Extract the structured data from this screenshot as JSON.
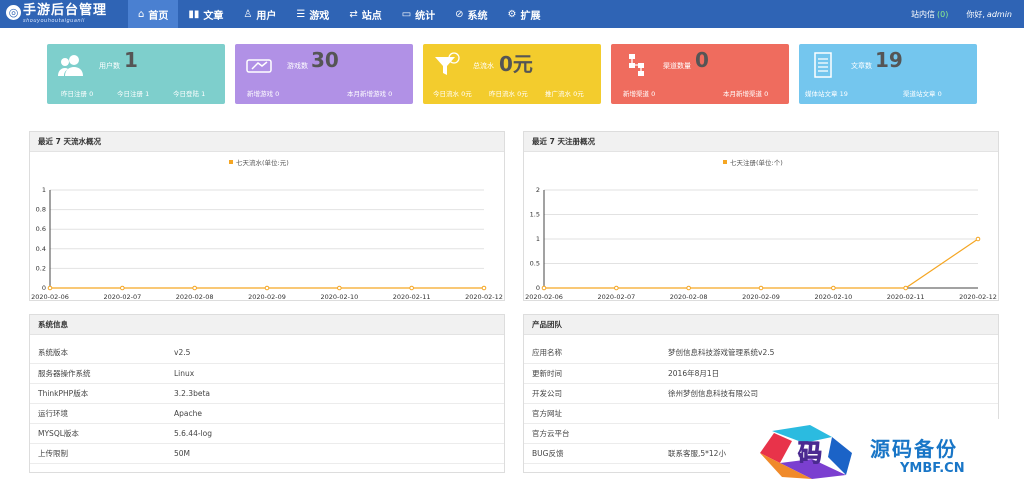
{
  "app": {
    "logo_text": "手游后台管理",
    "logo_sub": "shouyouhoutaiguanli"
  },
  "nav": [
    {
      "label": "首页",
      "icon": "home-icon"
    },
    {
      "label": "文章",
      "icon": "bar-chart-icon"
    },
    {
      "label": "用户",
      "icon": "user-icon"
    },
    {
      "label": "游戏",
      "icon": "list-icon"
    },
    {
      "label": "站点",
      "icon": "exchange-icon"
    },
    {
      "label": "统计",
      "icon": "monitor-icon"
    },
    {
      "label": "系统",
      "icon": "link-icon"
    },
    {
      "label": "扩展",
      "icon": "gear-icon"
    }
  ],
  "topright": {
    "messages_label": "站内信",
    "messages_count": "(0)",
    "greeting": "你好,",
    "user": "admin"
  },
  "stats": [
    {
      "label": "用户数",
      "value": "1",
      "color": "#7ecfcc",
      "icon": "users-icon",
      "foot": [
        "昨日注册 0",
        "今日注册 1",
        "今日登陆 1"
      ]
    },
    {
      "label": "游戏数",
      "value": "30",
      "color": "#b191e6",
      "icon": "gamepad-icon",
      "foot": [
        "新增游戏 0",
        "本月新增游戏 0"
      ]
    },
    {
      "label": "总流水",
      "value": "0元",
      "color": "#f3cc2d",
      "icon": "funnel-icon",
      "foot": [
        "今日流水 0元",
        "昨日流水 0元",
        "推广流水 0元"
      ]
    },
    {
      "label": "渠道数量",
      "value": "0",
      "color": "#ef6c5e",
      "icon": "sitemap-icon",
      "foot": [
        "新增渠道 0",
        "本月新增渠道 0"
      ]
    },
    {
      "label": "文章数",
      "value": "19",
      "color": "#74c6ee",
      "icon": "document-icon",
      "foot": [
        "媒体站文章 19",
        "渠道站文章 0"
      ]
    }
  ],
  "charts": {
    "left_title": "最近 7 天流水概况",
    "right_title": "最近 7 天注册概况"
  },
  "chart_data": [
    {
      "type": "line",
      "title": "最近 7 天流水概况",
      "x": [
        "2020-02-06",
        "2020-02-07",
        "2020-02-08",
        "2020-02-09",
        "2020-02-10",
        "2020-02-11",
        "2020-02-12"
      ],
      "series": [
        {
          "name": "七天流水(单位:元)",
          "values": [
            0,
            0,
            0,
            0,
            0,
            0,
            0
          ],
          "color": "#f5a623"
        }
      ],
      "ylim": [
        0,
        1
      ],
      "yticks": [
        "0",
        "0.2",
        "0.4",
        "0.6",
        "0.8",
        "1"
      ],
      "grid": true,
      "legend": "top-center"
    },
    {
      "type": "line",
      "title": "最近 7 天注册概况",
      "x": [
        "2020-02-06",
        "2020-02-07",
        "2020-02-08",
        "2020-02-09",
        "2020-02-10",
        "2020-02-11",
        "2020-02-12"
      ],
      "series": [
        {
          "name": "七天注册(单位:个)",
          "values": [
            0,
            0,
            0,
            0,
            0,
            0,
            1
          ],
          "color": "#f5a623"
        }
      ],
      "ylim": [
        0,
        2
      ],
      "yticks": [
        "0",
        "0.5",
        "1",
        "1.5",
        "2"
      ],
      "grid": true,
      "legend": "top-center"
    }
  ],
  "sysinfo": {
    "title": "系统信息",
    "rows": [
      [
        "系统版本",
        "v2.5"
      ],
      [
        "服务器操作系统",
        "Linux"
      ],
      [
        "ThinkPHP版本",
        "3.2.3beta"
      ],
      [
        "运行环境",
        "Apache"
      ],
      [
        "MYSQL版本",
        "5.6.44-log"
      ],
      [
        "上传限制",
        "50M"
      ]
    ]
  },
  "team": {
    "title": "产品团队",
    "rows": [
      [
        "应用名称",
        "梦创信息科技游戏管理系统v2.5"
      ],
      [
        "更新时间",
        "2016年8月1日"
      ],
      [
        "开发公司",
        "徐州梦创信息科技有限公司"
      ],
      [
        "官方网址",
        ""
      ],
      [
        "官方云平台",
        ""
      ],
      [
        "BUG反馈",
        "联系客服,5*12小"
      ]
    ]
  },
  "watermark": {
    "glyph": "码",
    "title": "源码备份",
    "url": "YMBF.CN"
  }
}
